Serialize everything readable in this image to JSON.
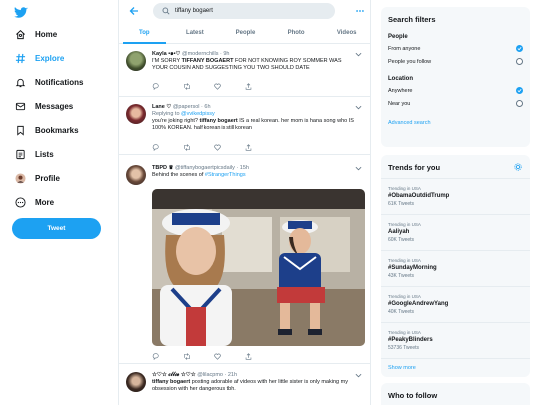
{
  "nav": {
    "items": [
      {
        "label": "Home",
        "icon": "home-icon"
      },
      {
        "label": "Explore",
        "icon": "hashtag-icon",
        "active": true
      },
      {
        "label": "Notifications",
        "icon": "bell-icon"
      },
      {
        "label": "Messages",
        "icon": "envelope-icon"
      },
      {
        "label": "Bookmarks",
        "icon": "bookmark-icon"
      },
      {
        "label": "Lists",
        "icon": "list-icon"
      },
      {
        "label": "Profile",
        "icon": "avatar"
      },
      {
        "label": "More",
        "icon": "more-circle-icon"
      }
    ],
    "tweet_button": "Tweet"
  },
  "search": {
    "query": "tiffany bogaert"
  },
  "tabs": [
    "Top",
    "Latest",
    "People",
    "Photo",
    "Videos"
  ],
  "tweets": [
    {
      "name": "Kayla •๑•♡",
      "meta": "@modernchills · 9h",
      "text_before": "I'M SORRY ",
      "text_bold": "TIFFANY BOGAERT",
      "text_after": " FOR NOT KNOWING ROY SOMMER WAS YOUR COUSIN AND SUGGESTING YOU TWO SHOULD DATE"
    },
    {
      "name": "Lane ♡",
      "meta": "@papersol · 6h",
      "reply_prefix": "Replying to ",
      "reply_to": "@vvikedpissy",
      "text_before": "you're joking right? ",
      "text_bold": "tiffany bogaert",
      "text_after": " IS a real korean. her mom is hana song who IS 100% KOREAN. half korean is still korean "
    },
    {
      "name": "TBPD ♛",
      "meta": "@tiffanybogaertpicsdaily · 15h",
      "text_plain": "Behind the scenes of ",
      "text_link": "#StrangerThings"
    },
    {
      "name": "☆♡☆ 𝓬𝓵𝓵𝓲𝓮 ☆♡☆",
      "meta": "@lilacpmo · 21h",
      "text_bold": "tiffany bogaert",
      "text_after": " posting adorable af videos with her little sister is only making my obsession with her dangerous tbh."
    }
  ],
  "filters": {
    "title": "Search filters",
    "people_label": "People",
    "people_options": [
      {
        "label": "From anyone",
        "selected": true
      },
      {
        "label": "People you follow",
        "selected": false
      }
    ],
    "location_label": "Location",
    "location_options": [
      {
        "label": "Anywhere",
        "selected": true
      },
      {
        "label": "Near you",
        "selected": false
      }
    ],
    "advanced": "Advanced search"
  },
  "trends": {
    "title": "Trends for you",
    "items": [
      {
        "context": "Trending in USA",
        "name": "#ObamaOutdidTrump",
        "count": "61K Tweets"
      },
      {
        "context": "Trending in USA",
        "name": "Aaliyah",
        "count": "60K Tweets"
      },
      {
        "context": "Trending in USA",
        "name": "#SundayMorning",
        "count": "43K Tweets"
      },
      {
        "context": "Trending in USA",
        "name": "#GoogleAndrewYang",
        "count": "40K Tweets"
      },
      {
        "context": "Trending in USA",
        "name": "#PeakyBlinders",
        "count": "53736 Tweets"
      }
    ],
    "show_more": "Show more"
  },
  "who_to_follow": {
    "title": "Who to follow"
  },
  "colors": {
    "accent": "#1da1f2",
    "text": "#14171a",
    "muted": "#657786",
    "divider": "#e6ecf0"
  }
}
